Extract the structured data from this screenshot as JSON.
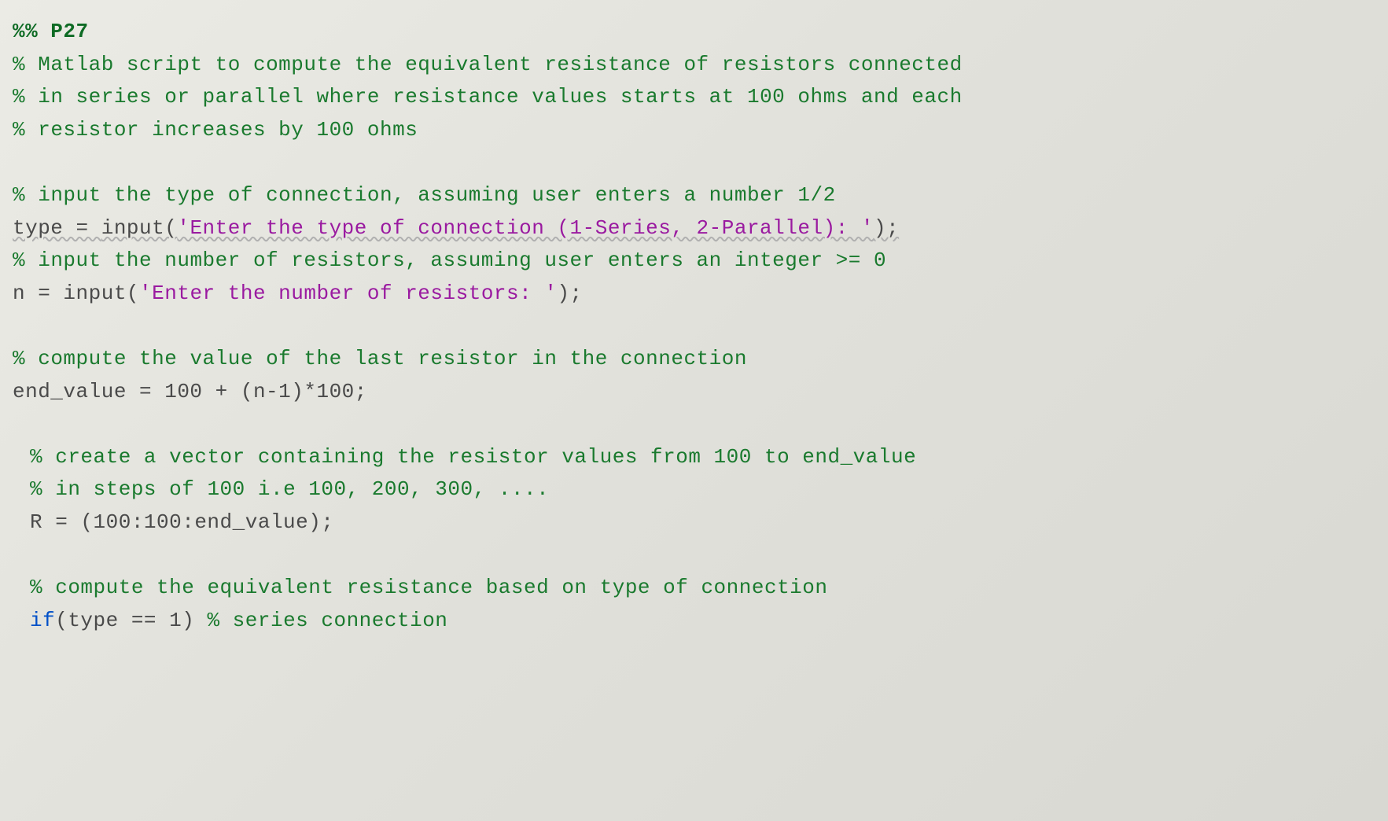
{
  "lines": {
    "l1": "%% P27",
    "l2_prefix": "% ",
    "l2": "Matlab script to compute the equivalent resistance of resistors connected",
    "l3_prefix": "% ",
    "l3": "in series or parallel where resistance values starts at 100 ohms and each",
    "l4_prefix": "% ",
    "l4": "resistor increases by 100 ohms",
    "l5_prefix": "% ",
    "l5": "input the type of connection, assuming user enters a number 1/2",
    "l6_var": "type = ",
    "l6_func": "input(",
    "l6_str": "'Enter the type of connection (1-Series, 2-Parallel): '",
    "l6_close": ");",
    "l7_prefix": "% ",
    "l7": "input the number of resistors, assuming user enters an integer >= 0",
    "l8_var": "n = ",
    "l8_func": "input(",
    "l8_str": "'Enter the number of resistors: '",
    "l8_close": ");",
    "l9_prefix": "% ",
    "l9": "compute the value of the last resistor in the connection",
    "l10": "end_value = 100 + (n-1)*100;",
    "l11_prefix": "% ",
    "l11": "create a vector containing the resistor values from 100 to end_value",
    "l12_prefix": "% ",
    "l12": "in steps of 100 i.e 100, 200, 300, ....",
    "l13": "R = (100:100:end_value);",
    "l14_prefix": "% ",
    "l14": "compute the equivalent resistance based on type of connection",
    "l15_if": "if",
    "l15_cond": "(type == 1) ",
    "l15_comment": "% series connection"
  }
}
